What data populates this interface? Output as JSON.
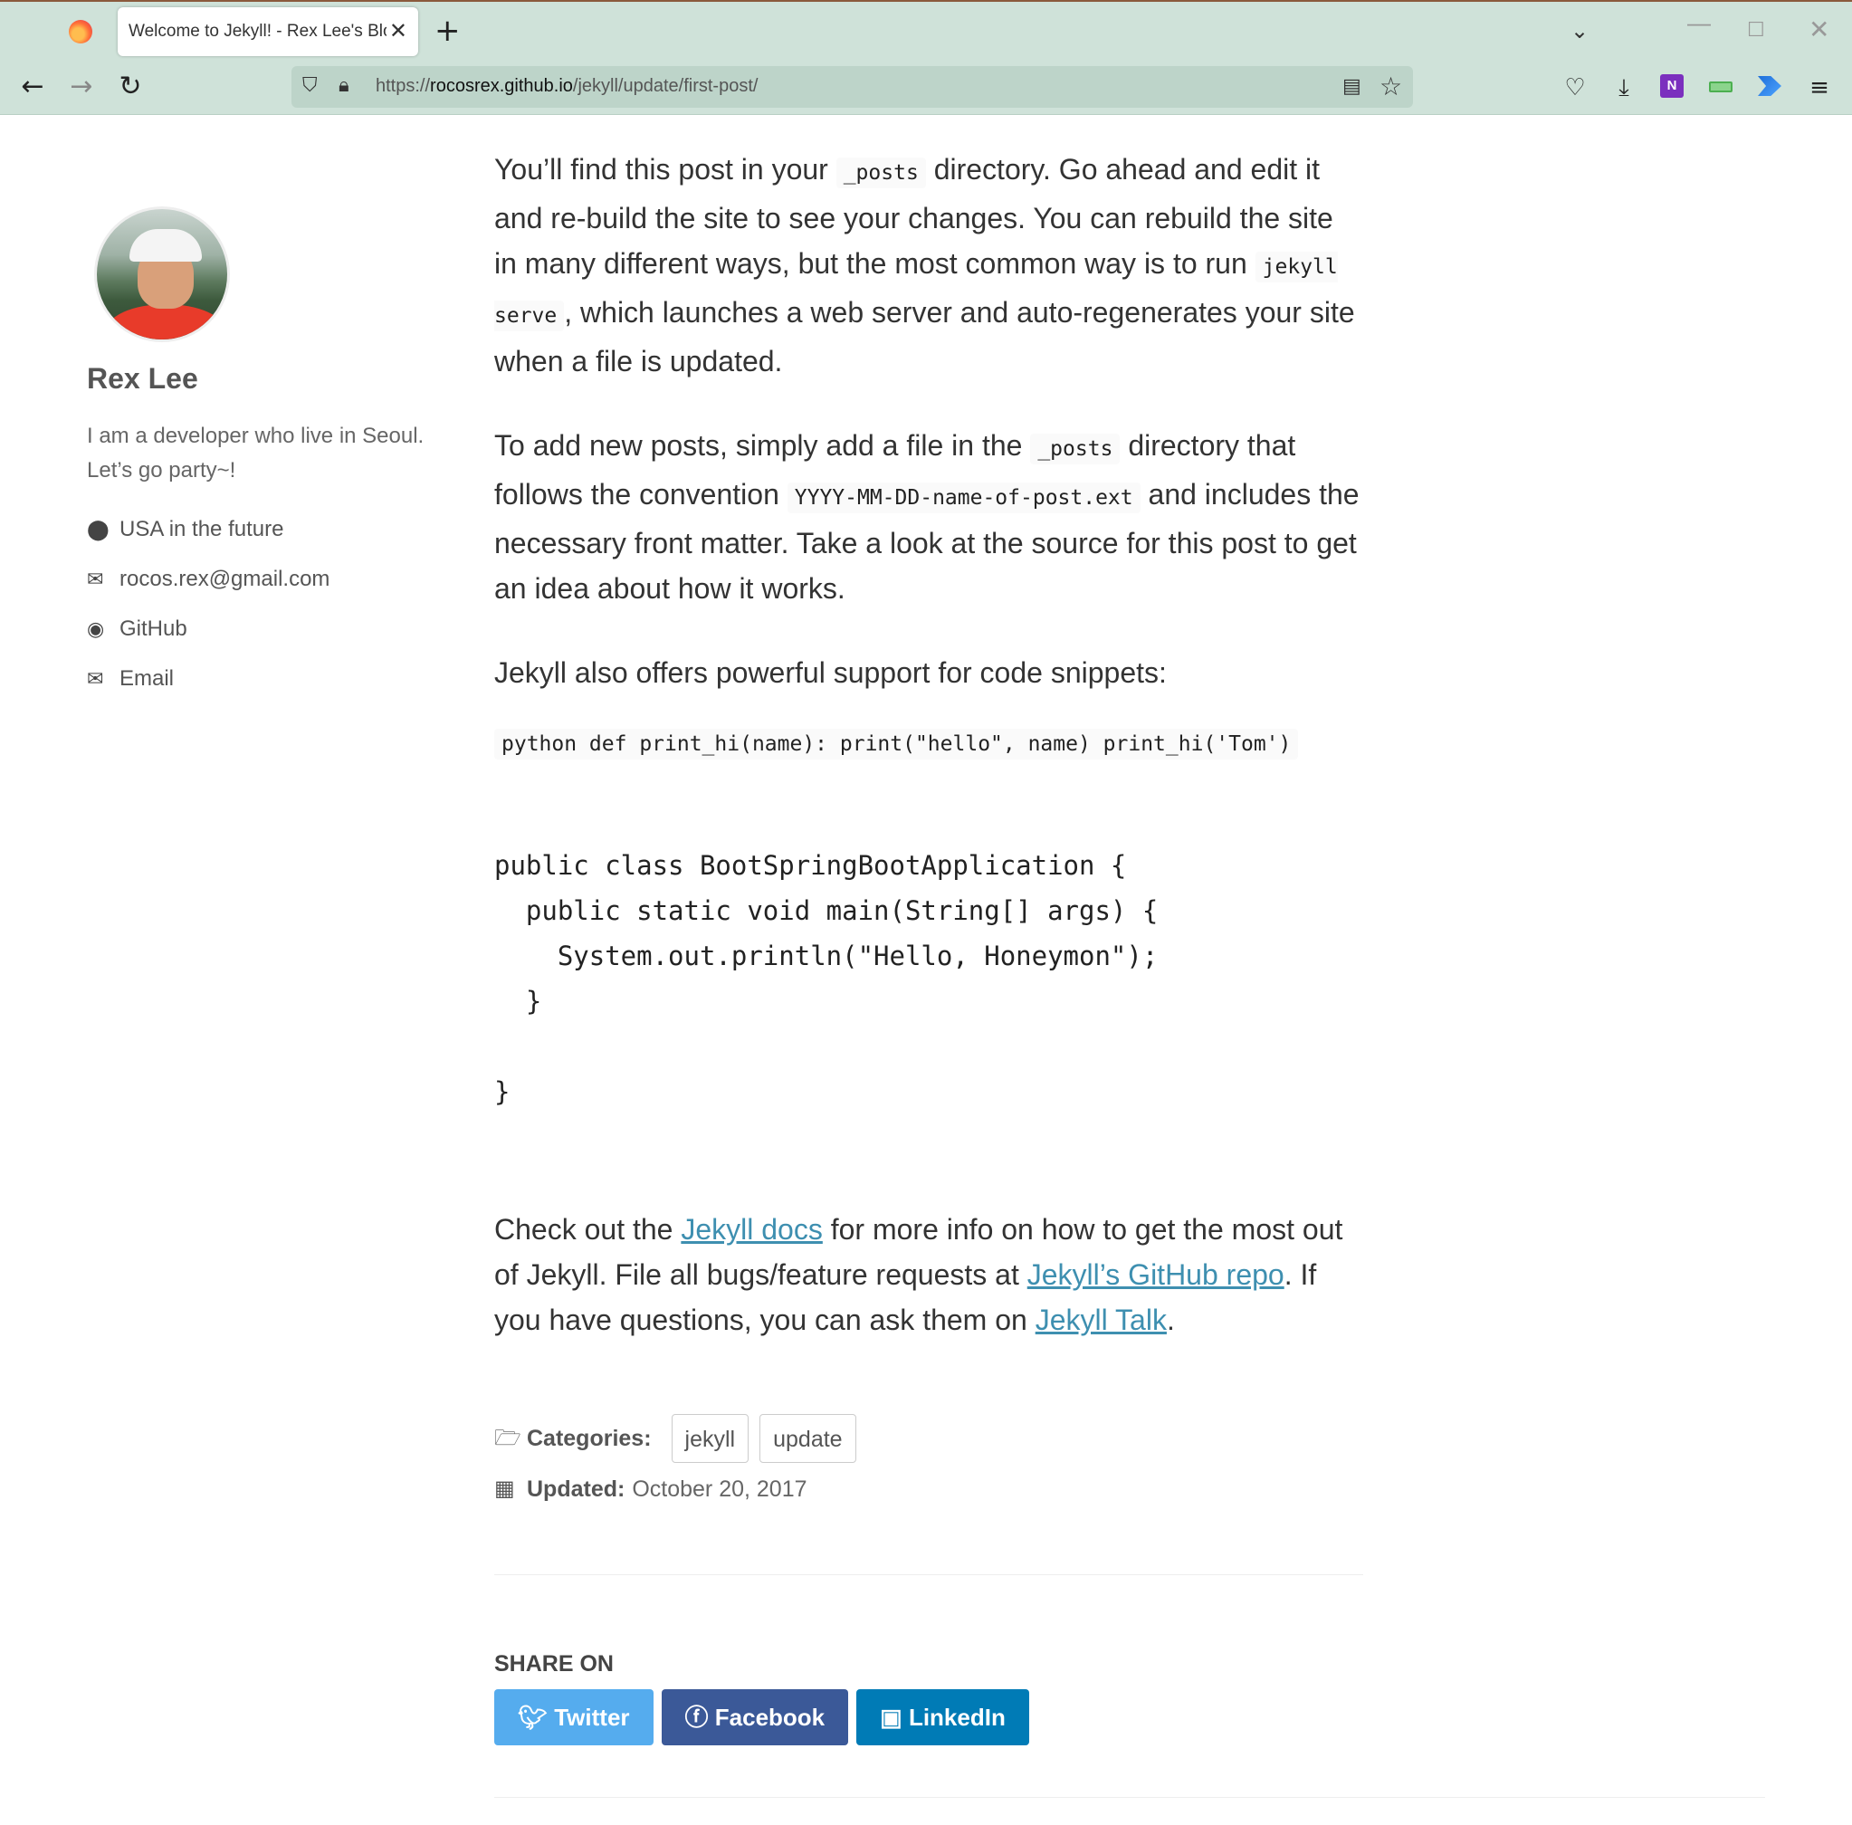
{
  "browser": {
    "tab_title": "Welcome to Jekyll! - Rex Lee's Blog",
    "url_scheme": "https://",
    "url_host": "rocosrex.github.io",
    "url_path": "/jekyll/update/first-post/",
    "new_tab_symbol": "+",
    "tab_close_symbol": "✕",
    "min_symbol": "—",
    "max_symbol": "☐",
    "close_symbol": "✕",
    "icons": [
      "firefox-logo",
      "back-arrow",
      "forward-arrow",
      "reload",
      "shield",
      "lock",
      "reader-view",
      "bookmark-star",
      "pocket",
      "download",
      "onenote",
      "battery",
      "power-automate",
      "menu"
    ]
  },
  "author": {
    "name": "Rex Lee",
    "bio": "I am a developer who live in Seoul. Let’s go party~!",
    "links": [
      {
        "label": "USA in the future",
        "icon": "map-marker"
      },
      {
        "label": "rocos.rex@gmail.com",
        "icon": "envelope"
      },
      {
        "label": "GitHub",
        "icon": "github"
      },
      {
        "label": "Email",
        "icon": "envelope"
      }
    ]
  },
  "post": {
    "p1_a": "You’ll find this post in your ",
    "p1_code1": "_posts",
    "p1_b": " directory. Go ahead and edit it and re-build the site to see your changes. You can rebuild the site in many different ways, but the most common way is to run ",
    "p1_code2": "jekyll serve",
    "p1_c": ", which launches a web server and auto-regenerates your site when a file is updated.",
    "p2_a": "To add new posts, simply add a file in the ",
    "p2_code1": "_posts",
    "p2_b": " directory that follows the convention ",
    "p2_code2": "YYYY-MM-DD-name-of-post.ext",
    "p2_c": " and includes the necessary front matter. Take a look at the source for this post to get an idea about how it works.",
    "p3": "Jekyll also offers powerful support for code snippets:",
    "inline_snippet": "python def print_hi(name): print(\"hello\", name) print_hi('Tom')",
    "code_block": "public class BootSpringBootApplication {\n  public static void main(String[] args) {\n    System.out.println(\"Hello, Honeymon\");\n  }\n\n}",
    "p4_a": "Check out the ",
    "p4_link1": "Jekyll docs",
    "p4_b": " for more info on how to get the most out of Jekyll. File all bugs/feature requests at ",
    "p4_link2": "Jekyll’s GitHub repo",
    "p4_c": ". If you have questions, you can ask them on ",
    "p4_link3": "Jekyll Talk",
    "p4_d": "."
  },
  "meta": {
    "categories_label": "Categories:",
    "categories": [
      "jekyll",
      "update"
    ],
    "updated_label": "Updated:",
    "updated_date": "October 20, 2017"
  },
  "share": {
    "title": "SHARE ON",
    "buttons": [
      "Twitter",
      "Facebook",
      "LinkedIn"
    ]
  },
  "colors": {
    "chrome": "#cfe2d9",
    "link": "#3e8fb0",
    "twitter": "#55acee",
    "facebook": "#3b5998",
    "linkedin": "#007bb6"
  }
}
